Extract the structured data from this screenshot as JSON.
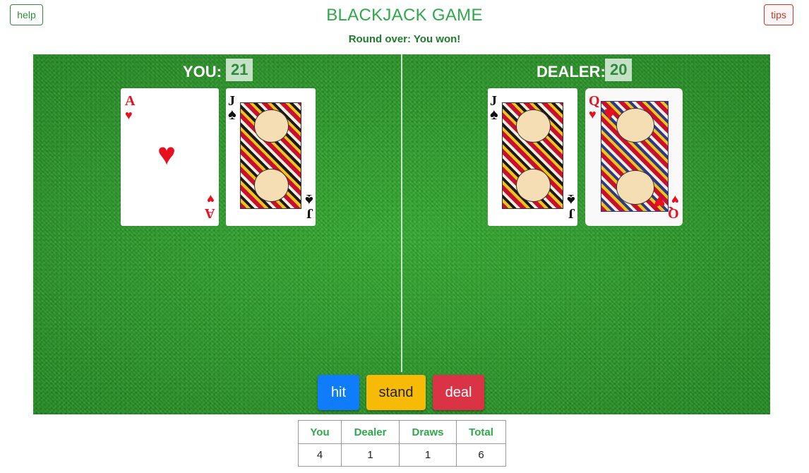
{
  "header": {
    "title": "BLACKJACK GAME",
    "status": "Round over: You won!",
    "help_label": "help",
    "tips_label": "tips"
  },
  "player": {
    "label": "YOU:",
    "score": "21",
    "cards": [
      {
        "rank": "A",
        "suit": "♥",
        "color": "red"
      },
      {
        "rank": "J",
        "suit": "♠",
        "color": "black"
      }
    ]
  },
  "dealer": {
    "label": "DEALER:",
    "score": "20",
    "cards": [
      {
        "rank": "J",
        "suit": "♠",
        "color": "black"
      },
      {
        "rank": "Q",
        "suit": "♥",
        "color": "red"
      }
    ]
  },
  "controls": {
    "hit": "hit",
    "stand": "stand",
    "deal": "deal"
  },
  "scoreboard": {
    "headers": [
      "You",
      "Dealer",
      "Draws",
      "Total"
    ],
    "values": [
      "4",
      "1",
      "1",
      "6"
    ]
  },
  "colors": {
    "title": "#2fa84a",
    "felt": "#2e9c2b",
    "hit": "#0f7cfb",
    "stand": "#f7bb06",
    "deal": "#db3346"
  }
}
